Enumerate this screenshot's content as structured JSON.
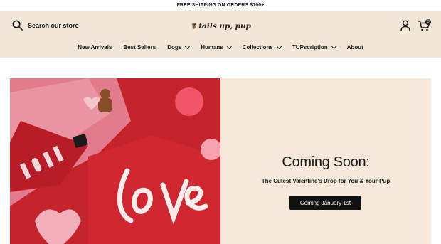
{
  "announcement": "FREE SHIPPING ON ORDERS $100+",
  "header": {
    "search_label": "Search our store",
    "logo_text": "tails up, pup",
    "cart_count": "0"
  },
  "nav": [
    {
      "label": "New Arrivals",
      "dropdown": false
    },
    {
      "label": "Best Sellers",
      "dropdown": false
    },
    {
      "label": "Dogs",
      "dropdown": true
    },
    {
      "label": "Humans",
      "dropdown": true
    },
    {
      "label": "Collections",
      "dropdown": true
    },
    {
      "label": "TUPscription",
      "dropdown": true
    },
    {
      "label": "About",
      "dropdown": false
    }
  ],
  "hero": {
    "title": "Coming Soon:",
    "subtitle": "The Cutest Valentine's Drop for You & Your Pup",
    "button_label": "Coming January 1st"
  },
  "colors": {
    "header_bg": "#f1e6d8",
    "panel_bg": "#f6e9dc",
    "button_bg": "#111111",
    "sweater_red": "#c72b33"
  }
}
